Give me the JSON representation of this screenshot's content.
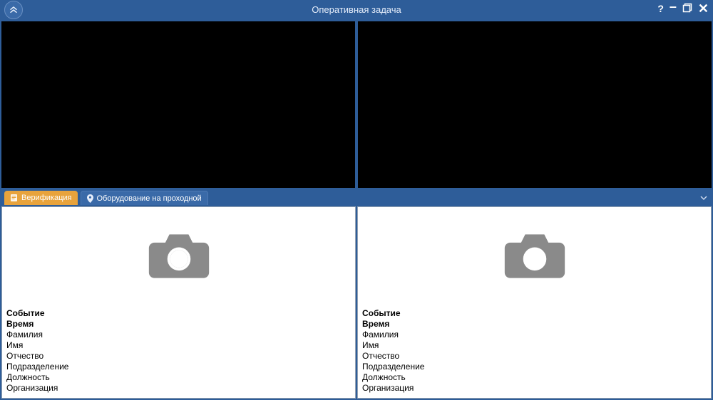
{
  "window": {
    "title": "Оперативная задача"
  },
  "tabs": {
    "verification": "Верификация",
    "equipment": "Оборудование на проходной"
  },
  "panel": {
    "left": {
      "fields": {
        "event": "Событие",
        "time": "Время",
        "lastname": "Фамилия",
        "firstname": "Имя",
        "patronymic": "Отчество",
        "department": "Подразделение",
        "position": "Должность",
        "organization": "Организация"
      }
    },
    "right": {
      "fields": {
        "event": "Событие",
        "time": "Время",
        "lastname": "Фамилия",
        "firstname": "Имя",
        "patronymic": "Отчество",
        "department": "Подразделение",
        "position": "Должность",
        "organization": "Организация"
      }
    }
  }
}
